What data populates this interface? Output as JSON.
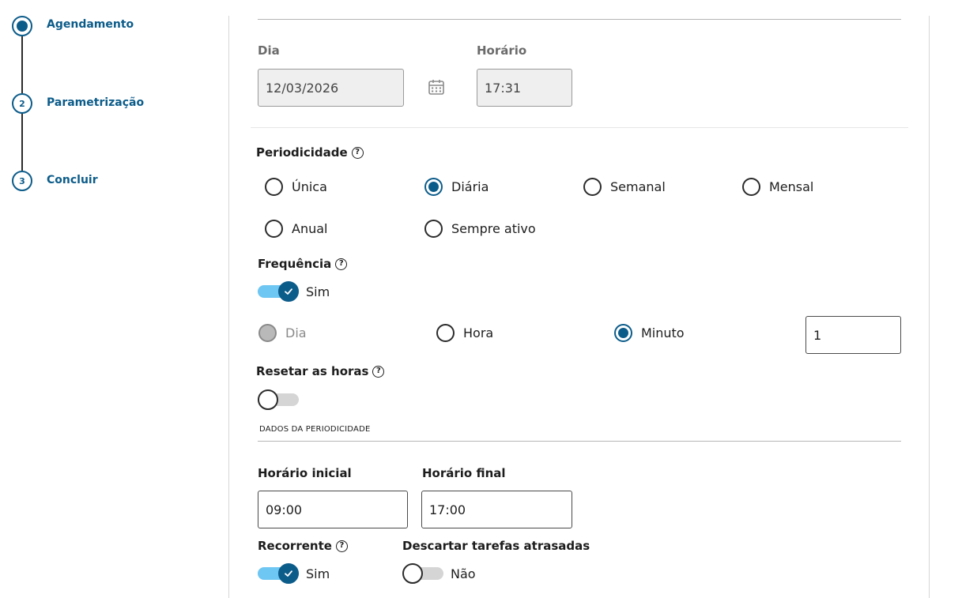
{
  "stepper": {
    "steps": [
      {
        "number": "1",
        "label": "Agendamento"
      },
      {
        "number": "2",
        "label": "Parametrização"
      },
      {
        "number": "3",
        "label": "Concluir"
      }
    ]
  },
  "schedule": {
    "day_label": "Dia",
    "day_value": "12/03/2026",
    "time_label": "Horário",
    "time_value": "17:31"
  },
  "periodicity": {
    "label": "Periodicidade",
    "options": [
      "Única",
      "Diária",
      "Semanal",
      "Mensal",
      "Anual",
      "Sempre ativo"
    ],
    "selected": "Diária"
  },
  "frequency": {
    "label": "Frequência",
    "toggle_label": "Sim",
    "units": [
      "Dia",
      "Hora",
      "Minuto"
    ],
    "selected": "Minuto",
    "value": "1"
  },
  "reset_hours": {
    "label": "Resetar as horas"
  },
  "periodicity_data": {
    "section_title": "DADOS DA PERIODICIDADE",
    "start_label": "Horário inicial",
    "start_value": "09:00",
    "end_label": "Horário final",
    "end_value": "17:00"
  },
  "recurring": {
    "label": "Recorrente",
    "toggle_label": "Sim"
  },
  "discard_late": {
    "label": "Descartar tarefas atrasadas",
    "toggle_label": "Não"
  },
  "colors": {
    "primary": "#0c5c8a",
    "toggle_on_track": "#6ec6f2"
  }
}
